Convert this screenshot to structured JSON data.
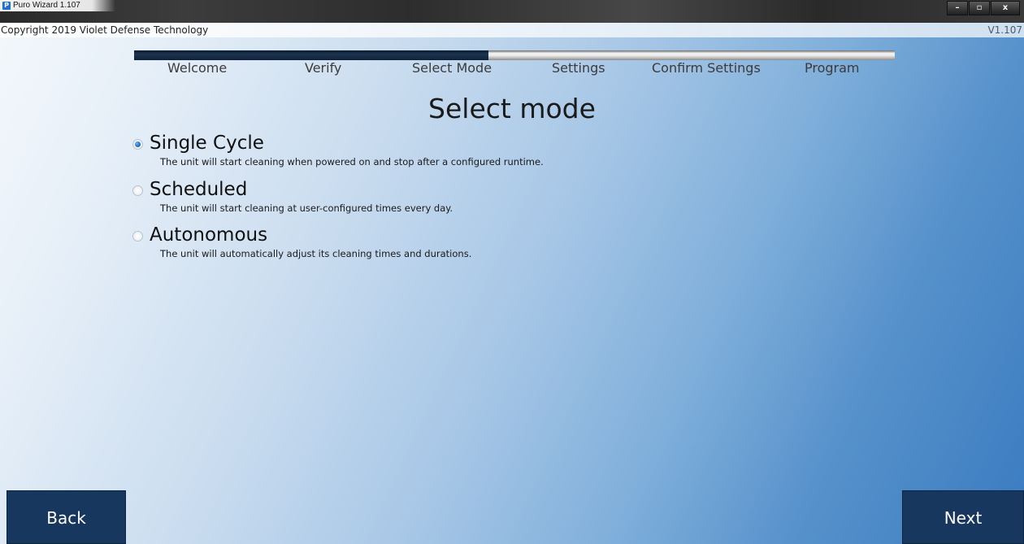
{
  "window": {
    "title": "Puro Wizard 1.107",
    "app_icon": "puro-p-icon",
    "controls": {
      "minimize": "–",
      "maximize": "▫",
      "close": "x"
    }
  },
  "header": {
    "copyright": "Copyright 2019 Violet Defense Technology",
    "version": "V1.107"
  },
  "progress": {
    "fraction": 0.466,
    "fill_color": "#16304f",
    "steps": [
      "Welcome",
      "Verify",
      "Select Mode",
      "Settings",
      "Confirm Settings",
      "Program"
    ],
    "current_step": "Select Mode"
  },
  "main": {
    "title": "Select mode",
    "options": [
      {
        "label": "Single Cycle",
        "description": "The unit will start cleaning when powered on and stop after a configured runtime.",
        "selected": true
      },
      {
        "label": "Scheduled",
        "description": "The unit will start cleaning at user-configured times every day.",
        "selected": false
      },
      {
        "label": "Autonomous",
        "description": "The unit will automatically adjust its cleaning times and durations.",
        "selected": false
      }
    ]
  },
  "footer": {
    "back_label": "Back",
    "next_label": "Next",
    "button_color": "#17375f"
  }
}
